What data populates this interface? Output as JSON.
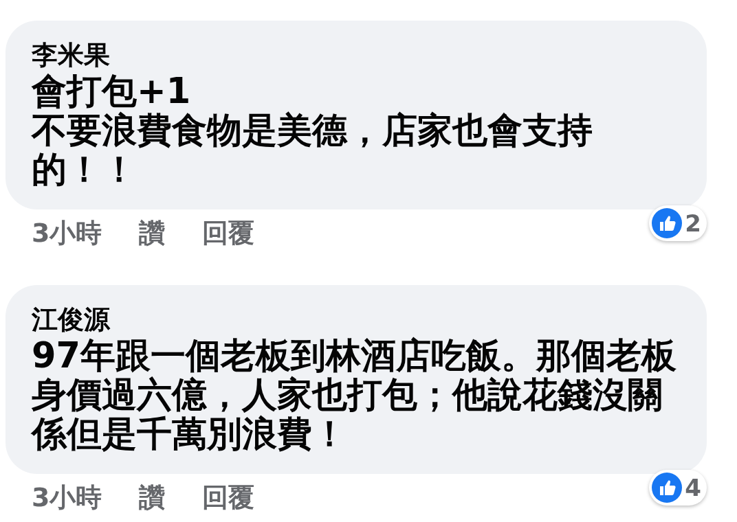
{
  "comments": [
    {
      "author": "李米果",
      "lines": [
        "會打包+1",
        "不要浪費食物是美德，店家也會支持的！！"
      ],
      "time": "3小時",
      "like": "讚",
      "reply": "回覆",
      "reaction_count": "2"
    },
    {
      "author": "江俊源",
      "lines": [
        "97年跟一個老板到林酒店吃飯。那個老板身價過六億，人家也打包；他說花錢沒關係但是千萬別浪費！"
      ],
      "time": "3小時",
      "like": "讚",
      "reply": "回覆",
      "reaction_count": "4"
    }
  ]
}
